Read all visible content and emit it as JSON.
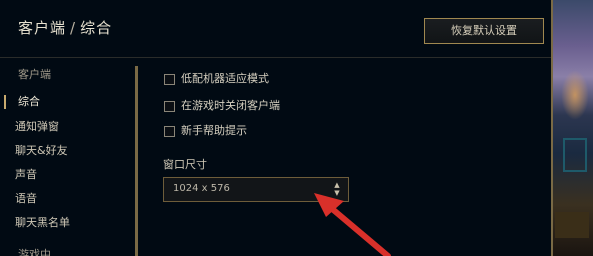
{
  "header": {
    "crumb_parent": "客户端",
    "crumb_sep": "/",
    "crumb_current": "综合",
    "restore_label": "恢复默认设置"
  },
  "sidebar": {
    "items": [
      {
        "label": "客户端",
        "kind": "section"
      },
      {
        "label": "综合",
        "kind": "active"
      },
      {
        "label": "通知弹窗",
        "kind": "item"
      },
      {
        "label": "聊天&好友",
        "kind": "item"
      },
      {
        "label": "声音",
        "kind": "item"
      },
      {
        "label": "语音",
        "kind": "item"
      },
      {
        "label": "聊天黑名单",
        "kind": "item"
      },
      {
        "label": "游戏中",
        "kind": "section"
      }
    ]
  },
  "options": {
    "low_spec": {
      "label": "低配机器适应模式",
      "checked": false
    },
    "close_in_game": {
      "label": "在游戏时关闭客户端",
      "checked": false
    },
    "tutorial_tips": {
      "label": "新手帮助提示",
      "checked": false
    }
  },
  "window_size": {
    "label": "窗口尺寸",
    "value": "1024 x 576"
  },
  "colors": {
    "accent_gold": "#c8aa6e",
    "annotation_red": "#d9302a",
    "background": "#010a13"
  },
  "icons": {
    "select_arrows": "up-down-chevron-icon",
    "annotation": "red-arrow-icon"
  }
}
